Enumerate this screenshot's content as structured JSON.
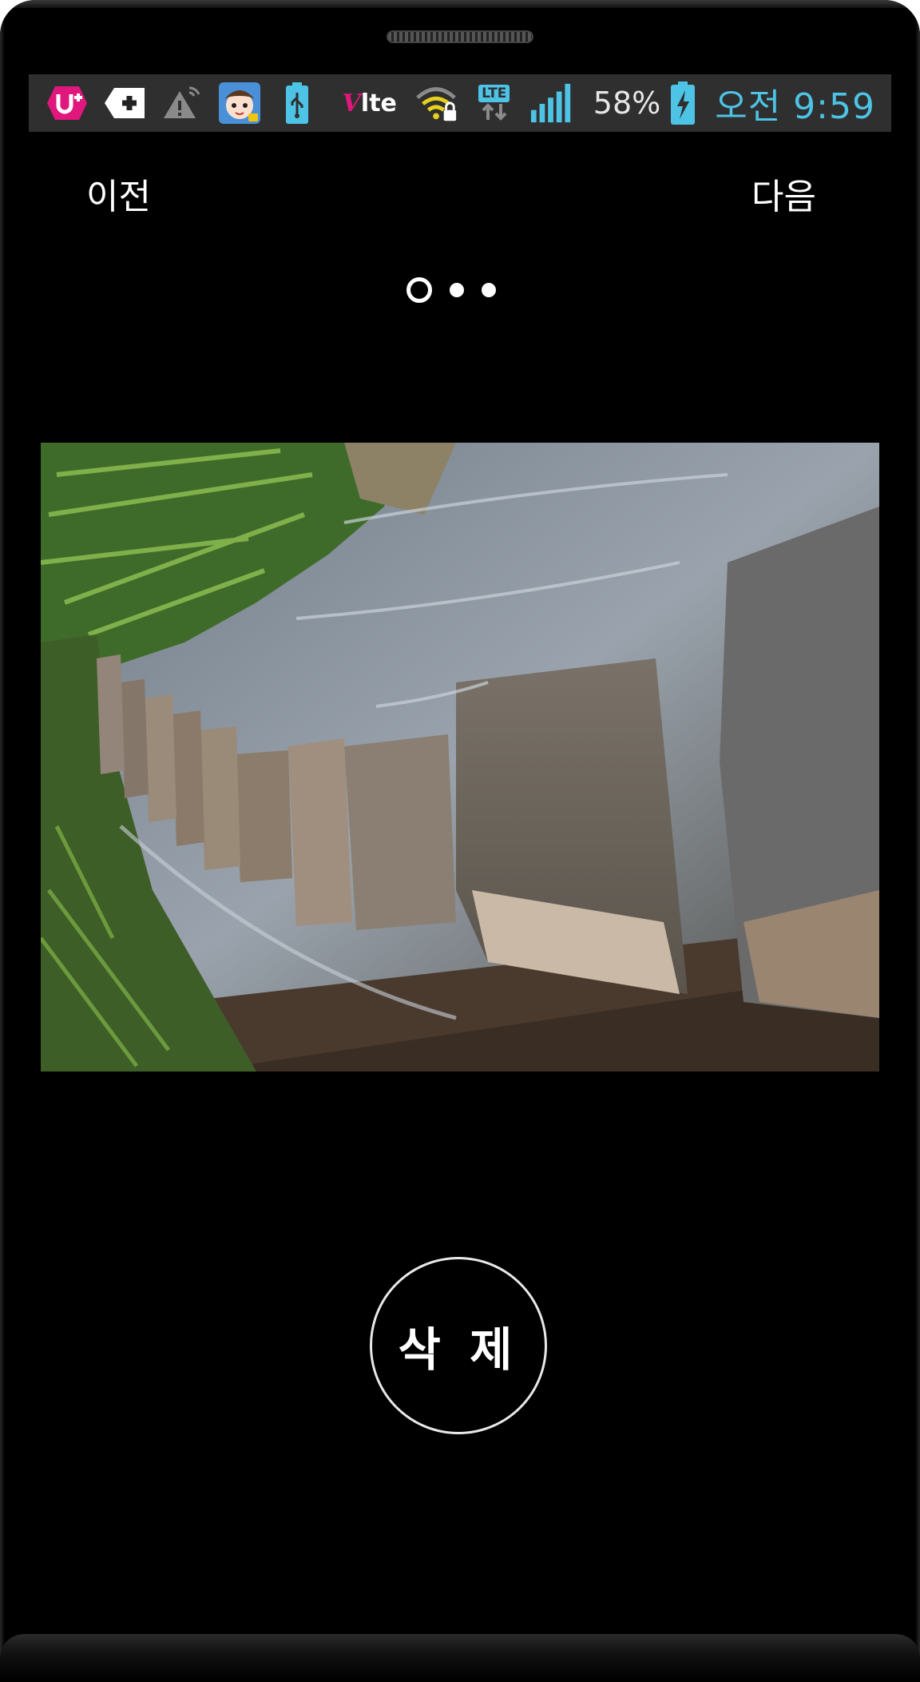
{
  "status_bar": {
    "icons": [
      "uplus-icon",
      "medical-plus-icon",
      "warning-icon",
      "app-avatar-icon",
      "usb-battery-icon",
      "vlte-icon",
      "wifi-lock-icon",
      "lte-data-icon",
      "signal-bars-icon",
      "battery-charging-icon"
    ],
    "vlte_label": "lte",
    "lte_label": "LTE",
    "battery_percent": "58%",
    "time": "오전 9:59",
    "accent_color": "#4dc3e6"
  },
  "nav": {
    "prev_label": "이전",
    "next_label": "다음"
  },
  "pager": {
    "total": 3,
    "current": 1
  },
  "photo": {
    "description_icon": "photo-stepping-stones"
  },
  "actions": {
    "delete_label": "삭 제"
  }
}
